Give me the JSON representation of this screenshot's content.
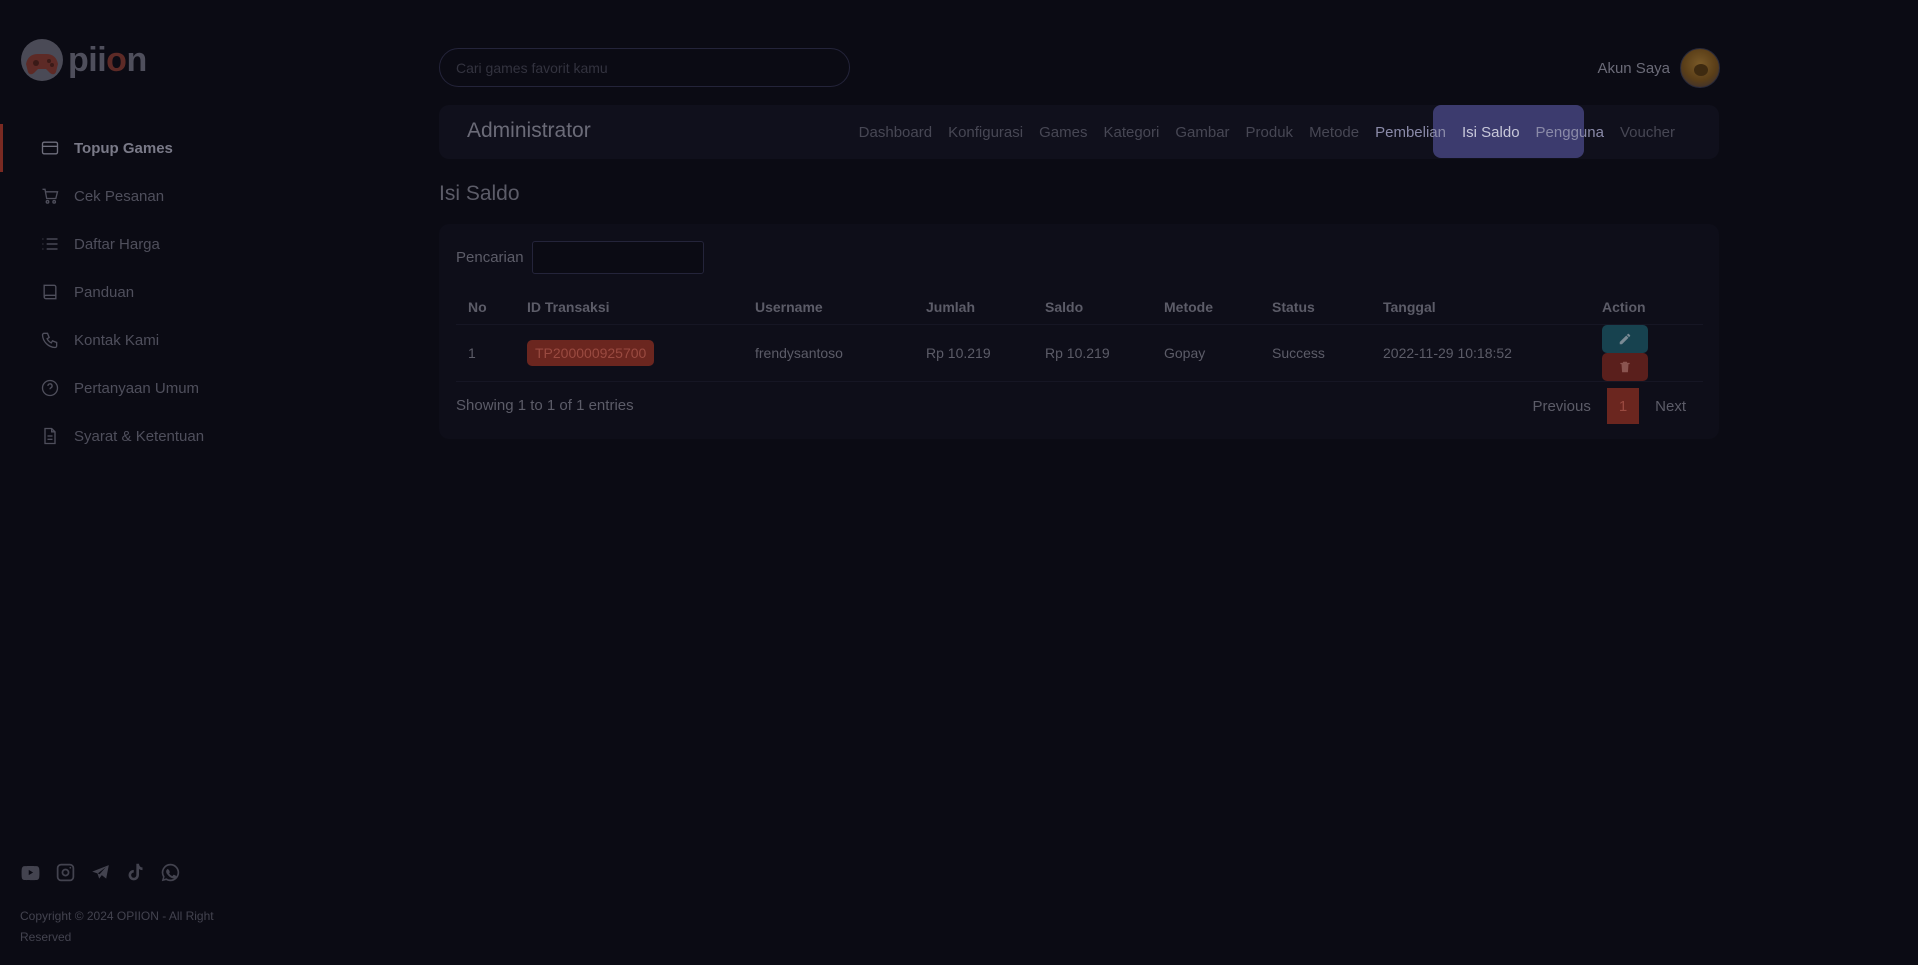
{
  "brand": {
    "logo_text": "pii",
    "logo_o": "o",
    "logo_end": "n"
  },
  "search": {
    "placeholder": "Cari games favorit kamu"
  },
  "account": {
    "label": "Akun Saya"
  },
  "sidebar": {
    "items": [
      {
        "label": "Topup Games",
        "icon": "card-icon"
      },
      {
        "label": "Cek Pesanan",
        "icon": "cart-icon"
      },
      {
        "label": "Daftar Harga",
        "icon": "list-icon"
      },
      {
        "label": "Panduan",
        "icon": "book-icon"
      },
      {
        "label": "Kontak Kami",
        "icon": "phone-icon"
      },
      {
        "label": "Pertanyaan Umum",
        "icon": "question-icon"
      },
      {
        "label": "Syarat & Ketentuan",
        "icon": "document-icon"
      }
    ],
    "copyright": "Copyright © 2024 OPIION - All Right Reserved"
  },
  "admin": {
    "title": "Administrator",
    "tabs": [
      "Dashboard",
      "Konfigurasi",
      "Games",
      "Kategori",
      "Gambar",
      "Produk",
      "Metode",
      "Pembelian",
      "Isi Saldo",
      "Pengguna",
      "Voucher"
    ],
    "active_tab": "Isi Saldo"
  },
  "page": {
    "title": "Isi Saldo"
  },
  "table": {
    "search_label": "Pencarian",
    "columns": [
      "No",
      "ID Transaksi",
      "Username",
      "Jumlah",
      "Saldo",
      "Metode",
      "Status",
      "Tanggal",
      "Action"
    ],
    "rows": [
      {
        "no": "1",
        "id": "TP200000925700",
        "username": "frendysantoso",
        "jumlah": "Rp 10.219",
        "saldo": "Rp 10.219",
        "metode": "Gopay",
        "status": "Success",
        "tanggal": "2022-11-29 10:18:52"
      }
    ],
    "showing": "Showing 1 to 1 of 1 entries",
    "pager": {
      "previous": "Previous",
      "page": "1",
      "next": "Next"
    }
  },
  "colors": {
    "accent": "#6b261f",
    "highlight": "#3c3b6e",
    "edit": "#17424f"
  }
}
